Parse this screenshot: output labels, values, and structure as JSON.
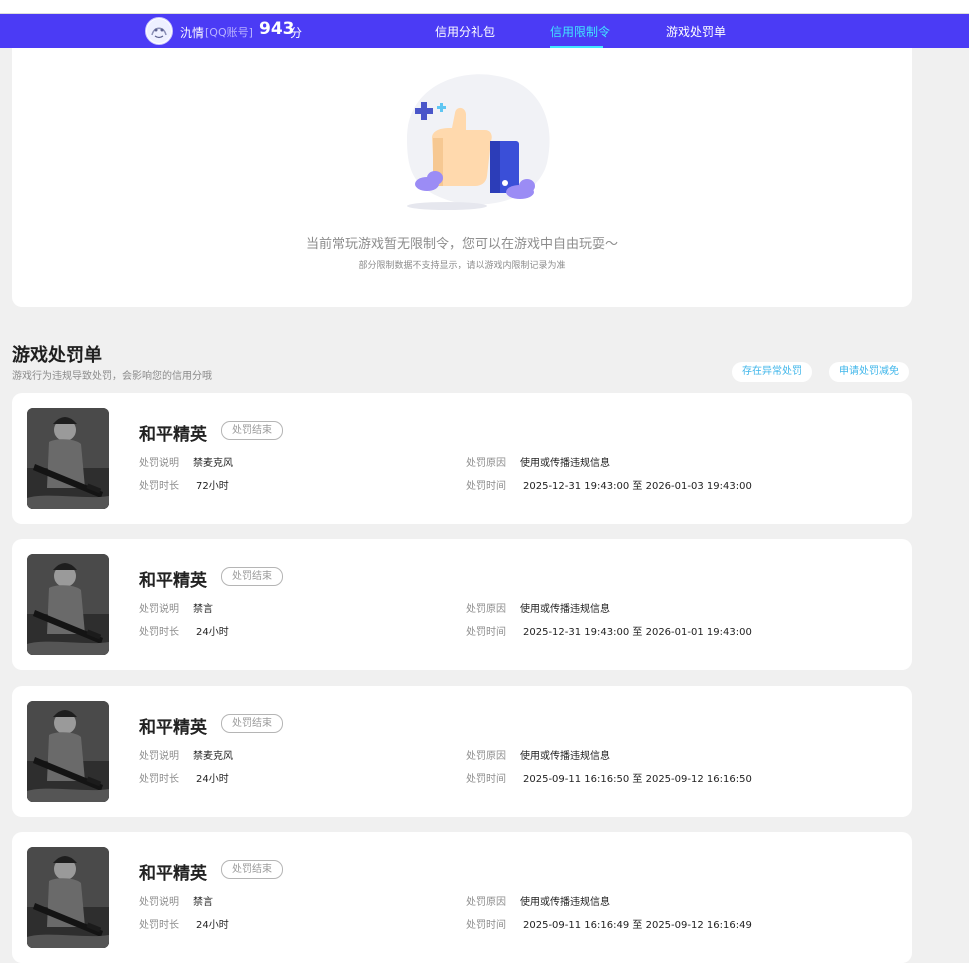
{
  "header": {
    "nickname": "氿情",
    "account_tag": "[QQ账号]",
    "score": "943",
    "score_unit": "分",
    "nav": [
      "信用分礼包",
      "信用限制令",
      "游戏处罚单"
    ],
    "active_tab": "信用限制令",
    "brand_color": "#4b3bf5",
    "accent_color": "#41e6ff"
  },
  "restriction": {
    "empty_message": "当前常玩游戏暂无限制令，您可以在游戏中自由玩耍～",
    "empty_note": "部分限制数据不支持显示，请以游戏内限制记录为准",
    "illustration": "thumbs-up-phone-illustration"
  },
  "penalties": {
    "title": "游戏处罚单",
    "subtitle": "游戏行为违规导致处罚，会影响您的信用分哦",
    "buttons": [
      "存在异常处罚",
      "申请处罚减免"
    ],
    "labels": {
      "desc": "处罚说明",
      "duration": "处罚时长",
      "reason": "处罚原因",
      "time": "处罚时间"
    },
    "items": [
      {
        "game": "和平精英",
        "status": "处罚结束",
        "desc": "禁麦克风",
        "duration": "72小时",
        "reason": "使用或传播违规信息",
        "time_start": "2025-12-31 19:43:00",
        "time_sep": "至",
        "time_end": "2026-01-03 19:43:00"
      },
      {
        "game": "和平精英",
        "status": "处罚结束",
        "desc": "禁言",
        "duration": "24小时",
        "reason": "使用或传播违规信息",
        "time_start": "2025-12-31 19:43:00",
        "time_sep": "至",
        "time_end": "2026-01-01 19:43:00"
      },
      {
        "game": "和平精英",
        "status": "处罚结束",
        "desc": "禁麦克风",
        "duration": "24小时",
        "reason": "使用或传播违规信息",
        "time_start": "2025-09-11 16:16:50",
        "time_sep": "至",
        "time_end": "2025-09-12 16:16:50"
      },
      {
        "game": "和平精英",
        "status": "处罚结束",
        "desc": "禁言",
        "duration": "24小时",
        "reason": "使用或传播违规信息",
        "time_start": "2025-09-11 16:16:49",
        "time_sep": "至",
        "time_end": "2025-09-12 16:16:49"
      }
    ]
  }
}
